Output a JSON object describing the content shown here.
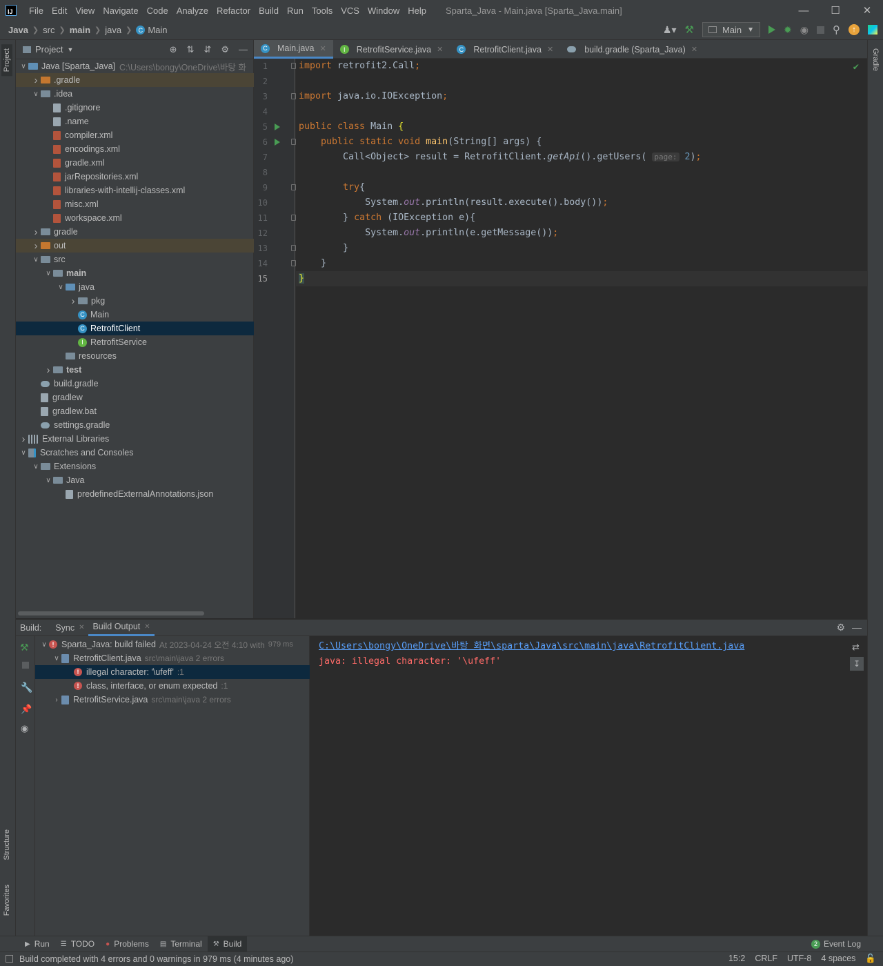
{
  "menubar": {
    "items": [
      "File",
      "Edit",
      "View",
      "Navigate",
      "Code",
      "Analyze",
      "Refactor",
      "Build",
      "Run",
      "Tools",
      "VCS",
      "Window",
      "Help"
    ],
    "window_title": "Sparta_Java - Main.java [Sparta_Java.main]"
  },
  "navbar": {
    "crumbs": [
      "Java",
      "src",
      "main",
      "java",
      "Main"
    ],
    "run_config": "Main"
  },
  "stripes": {
    "left_top": "Project",
    "left_mid": "Structure",
    "left_bottom": "Favorites",
    "right": "Gradle"
  },
  "project": {
    "title": "Project",
    "tree": [
      {
        "label": "Java [Sparta_Java]",
        "dim": "C:\\Users\\bongy\\OneDrive\\바탕 화",
        "level": 0,
        "arrow": "v",
        "icon": "module"
      },
      {
        "label": ".gradle",
        "level": 1,
        "arrow": ">",
        "icon": "folder-orange",
        "hl": true
      },
      {
        "label": ".idea",
        "level": 1,
        "arrow": "v",
        "icon": "folder"
      },
      {
        "label": ".gitignore",
        "level": 2,
        "icon": "file"
      },
      {
        "label": ".name",
        "level": 2,
        "icon": "file"
      },
      {
        "label": "compiler.xml",
        "level": 2,
        "icon": "xml"
      },
      {
        "label": "encodings.xml",
        "level": 2,
        "icon": "xml"
      },
      {
        "label": "gradle.xml",
        "level": 2,
        "icon": "xml"
      },
      {
        "label": "jarRepositories.xml",
        "level": 2,
        "icon": "xml"
      },
      {
        "label": "libraries-with-intellij-classes.xml",
        "level": 2,
        "icon": "xml"
      },
      {
        "label": "misc.xml",
        "level": 2,
        "icon": "xml"
      },
      {
        "label": "workspace.xml",
        "level": 2,
        "icon": "xml"
      },
      {
        "label": "gradle",
        "level": 1,
        "arrow": ">",
        "icon": "folder"
      },
      {
        "label": "out",
        "level": 1,
        "arrow": ">",
        "icon": "folder-orange",
        "hl": true
      },
      {
        "label": "src",
        "level": 1,
        "arrow": "v",
        "icon": "folder"
      },
      {
        "label": "main",
        "level": 2,
        "arrow": "v",
        "icon": "folder",
        "bold": true
      },
      {
        "label": "java",
        "level": 3,
        "arrow": "v",
        "icon": "folder-blue"
      },
      {
        "label": "pkg",
        "level": 4,
        "arrow": ">",
        "icon": "folder"
      },
      {
        "label": "Main",
        "level": 4,
        "icon": "class"
      },
      {
        "label": "RetrofitClient",
        "level": 4,
        "icon": "class",
        "sel": true
      },
      {
        "label": "RetrofitService",
        "level": 4,
        "icon": "interface"
      },
      {
        "label": "resources",
        "level": 3,
        "icon": "folder"
      },
      {
        "label": "test",
        "level": 2,
        "arrow": ">",
        "icon": "folder",
        "bold": true
      },
      {
        "label": "build.gradle",
        "level": 1,
        "icon": "gradle"
      },
      {
        "label": "gradlew",
        "level": 1,
        "icon": "file"
      },
      {
        "label": "gradlew.bat",
        "level": 1,
        "icon": "file"
      },
      {
        "label": "settings.gradle",
        "level": 1,
        "icon": "gradle"
      },
      {
        "label": "External Libraries",
        "level": 0,
        "arrow": ">",
        "icon": "lib"
      },
      {
        "label": "Scratches and Consoles",
        "level": 0,
        "arrow": "v",
        "icon": "scratch"
      },
      {
        "label": "Extensions",
        "level": 1,
        "arrow": "v",
        "icon": "folder"
      },
      {
        "label": "Java",
        "level": 2,
        "arrow": "v",
        "icon": "folder"
      },
      {
        "label": "predefinedExternalAnnotations.json",
        "level": 3,
        "icon": "file"
      }
    ]
  },
  "editor": {
    "tabs": [
      {
        "label": "Main.java",
        "icon": "class",
        "active": true
      },
      {
        "label": "RetrofitService.java",
        "icon": "interface"
      },
      {
        "label": "RetrofitClient.java",
        "icon": "class"
      },
      {
        "label": "build.gradle (Sparta_Java)",
        "icon": "gradle"
      }
    ],
    "line_numbers": [
      "1",
      "2",
      "3",
      "4",
      "5",
      "6",
      "7",
      "8",
      "9",
      "10",
      "11",
      "12",
      "13",
      "14",
      "15"
    ],
    "current_line": "15",
    "param_hint": "page:"
  },
  "build": {
    "label": "Build:",
    "tabs": [
      "Sync",
      "Build Output"
    ],
    "tree": [
      {
        "label": "Sparta_Java: build failed",
        "dim": "At 2023-04-24 오전 4:10 with",
        "dim2": "979 ms",
        "level": 0,
        "arrow": "v",
        "icon": "err"
      },
      {
        "label": "RetrofitClient.java",
        "dim": "src\\main\\java 2 errors",
        "level": 1,
        "arrow": "v",
        "icon": "jfile"
      },
      {
        "label": "illegal character: '\\ufeff'",
        "dim": ":1",
        "level": 2,
        "icon": "err",
        "sel": true
      },
      {
        "label": "class, interface, or enum expected",
        "dim": ":1",
        "level": 2,
        "icon": "err"
      },
      {
        "label": "RetrofitService.java",
        "dim": "src\\main\\java 2 errors",
        "level": 1,
        "arrow": ">",
        "icon": "jfile"
      }
    ],
    "output_link": "C:\\Users\\bongy\\OneDrive\\바탕 화면\\sparta\\Java\\src\\main\\java\\RetrofitClient.java",
    "output_error": "java: illegal character: '\\ufeff'"
  },
  "bottom_tabs": [
    "Run",
    "TODO",
    "Problems",
    "Terminal",
    "Build"
  ],
  "status": {
    "message": "Build completed with 4 errors and 0 warnings in 979 ms (4 minutes ago)",
    "event_log_count": "2",
    "event_log": "Event Log",
    "position": "15:2",
    "line_sep": "CRLF",
    "encoding": "UTF-8",
    "indent": "4 spaces"
  },
  "colors": {
    "accent": "#4a88c7",
    "error": "#c75450",
    "run_green": "#499c54"
  }
}
